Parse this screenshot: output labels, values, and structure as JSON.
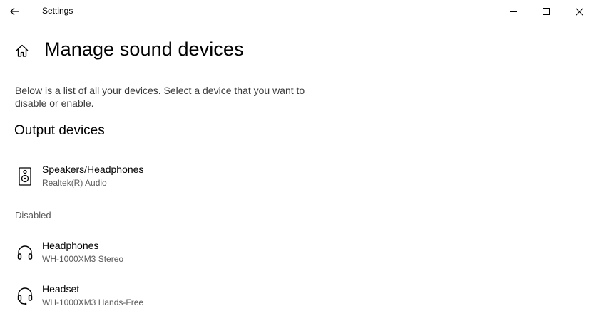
{
  "window": {
    "app_title": "Settings"
  },
  "icons": {
    "back": "back-arrow-icon",
    "minimize": "minimize-icon",
    "maximize": "maximize-icon",
    "close": "close-icon",
    "home": "home-icon",
    "speaker": "speaker-icon",
    "headphones": "headphones-icon",
    "headset": "headset-icon"
  },
  "page": {
    "title": "Manage sound devices",
    "description": "Below is a list of all your devices. Select a device that you want to disable or enable."
  },
  "output": {
    "heading": "Output devices",
    "enabled": [
      {
        "name": "Speakers/Headphones",
        "subtitle": "Realtek(R) Audio",
        "icon": "speaker-icon"
      }
    ],
    "disabled_label": "Disabled",
    "disabled": [
      {
        "name": "Headphones",
        "subtitle": "WH-1000XM3 Stereo",
        "icon": "headphones-icon"
      },
      {
        "name": "Headset",
        "subtitle": "WH-1000XM3 Hands-Free",
        "icon": "headset-icon"
      }
    ]
  }
}
